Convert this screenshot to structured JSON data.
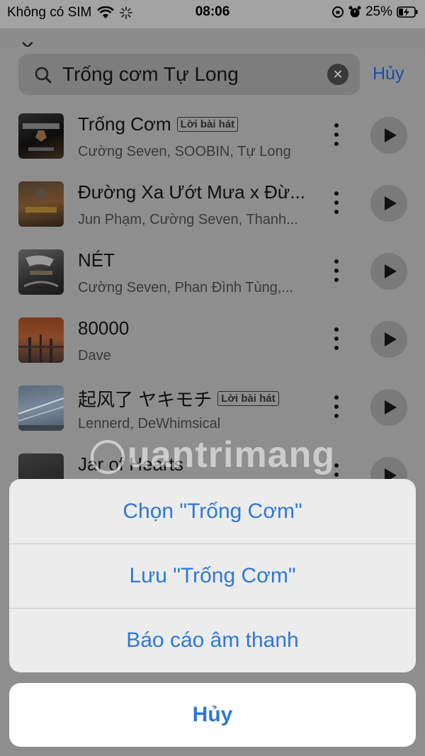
{
  "status_bar": {
    "carrier": "Không có SIM",
    "time": "08:06",
    "battery": "25%"
  },
  "search": {
    "query": "Trống cơm Tự Long",
    "cancel_label": "Hủy"
  },
  "songs": [
    {
      "title": "Trống Cơm",
      "badge": "Lời bài hát",
      "artist": "Cường Seven, SOOBIN, Tự Long"
    },
    {
      "title": "Đường Xa Ướt Mưa x Đừ...",
      "badge": "",
      "artist": "Jun Phạm, Cường Seven, Thanh..."
    },
    {
      "title": "NÉT",
      "badge": "",
      "artist": "Cường Seven, Phan Đình Tùng,..."
    },
    {
      "title": "80000",
      "badge": "",
      "artist": "Dave"
    },
    {
      "title": "起风了 ヤキモチ",
      "badge": "Lời bài hát",
      "artist": "Lennerd, DeWhimsical"
    },
    {
      "title": "Jar of Hearts",
      "badge": "",
      "artist": ""
    }
  ],
  "watermark": "uantrimang",
  "action_sheet": {
    "actions": [
      {
        "label": "Chọn \"Trống Cơm\""
      },
      {
        "label": "Lưu \"Trống Cơm\""
      },
      {
        "label": "Báo cáo âm thanh"
      }
    ],
    "cancel_label": "Hủy"
  },
  "colors": {
    "accent": "#2f78d6",
    "sheet_bg": "#ececec",
    "dim_bg": "#8e8e8e"
  }
}
